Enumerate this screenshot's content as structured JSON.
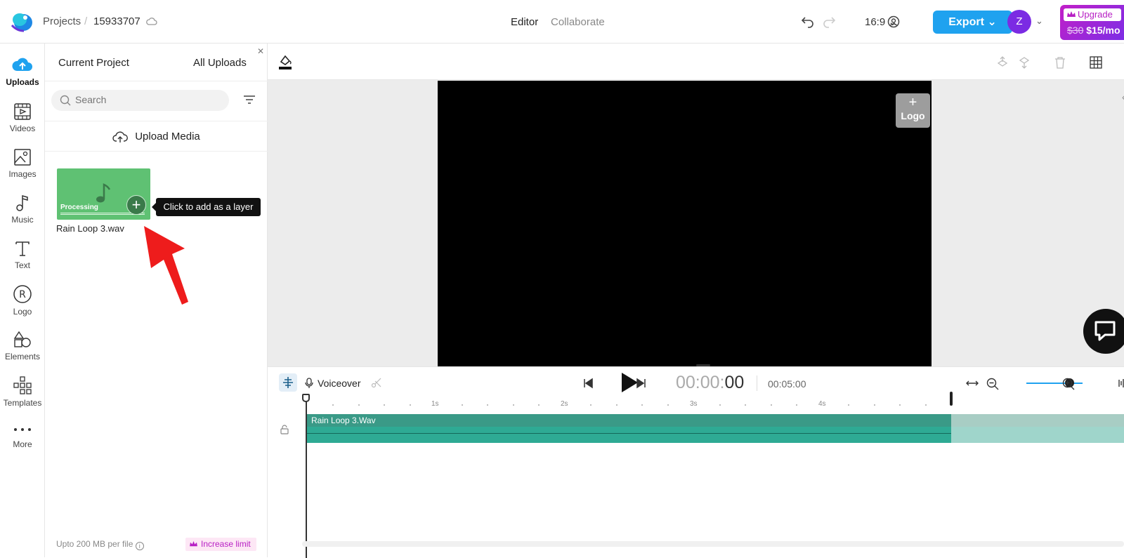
{
  "topbar": {
    "breadcrumb_projects": "Projects",
    "breadcrumb_sep": "/",
    "project_id": "15933707",
    "tab_editor": "Editor",
    "tab_collaborate": "Collaborate",
    "aspect_ratio": "16:9",
    "export_label": "Export",
    "avatar_initial": "Z",
    "upgrade_label": "Upgrade",
    "old_price": "$30",
    "new_price": "$15/mo"
  },
  "sidebar": {
    "items": [
      {
        "label": "Uploads",
        "icon": "cloud-upload-icon"
      },
      {
        "label": "Videos",
        "icon": "video-icon"
      },
      {
        "label": "Images",
        "icon": "image-icon"
      },
      {
        "label": "Music",
        "icon": "music-icon"
      },
      {
        "label": "Text",
        "icon": "text-icon"
      },
      {
        "label": "Logo",
        "icon": "logo-icon"
      },
      {
        "label": "Elements",
        "icon": "elements-icon"
      },
      {
        "label": "Templates",
        "icon": "templates-icon"
      },
      {
        "label": "More",
        "icon": "more-icon"
      }
    ]
  },
  "panel": {
    "tab_current": "Current Project",
    "tab_all": "All Uploads",
    "search_placeholder": "Search",
    "upload_media": "Upload Media",
    "media": {
      "status": "Processing",
      "name": "Rain Loop 3.wav"
    },
    "tooltip": "Click to add as a layer",
    "footer_limit": "Upto 200 MB per file",
    "increase_limit": "Increase limit"
  },
  "canvas": {
    "logo_label": "Logo",
    "logo_plus": "+"
  },
  "timeline": {
    "voiceover": "Voiceover",
    "time_dim": "00:00:",
    "time_bold": "00",
    "total_time": "00:05:00",
    "ruler_labels": [
      "1s",
      "2s",
      "3s",
      "4s"
    ],
    "clip_name": "Rain Loop 3.Wav"
  },
  "colors": {
    "accent": "#1fa2ef",
    "clip": "#2eaa94",
    "upgrade_start": "#c21fc8",
    "upgrade_end": "#7a2ee6"
  }
}
